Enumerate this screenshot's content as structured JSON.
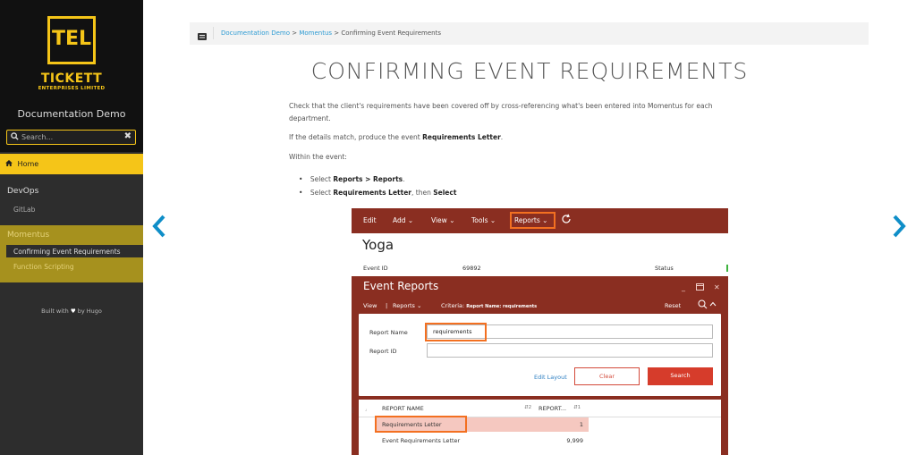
{
  "sidebar": {
    "logo": {
      "mark": "TEL",
      "name": "TICKETT",
      "tagline": "ENTERPRISES LIMITED"
    },
    "site_title": "Documentation Demo",
    "search": {
      "placeholder": "Search..."
    },
    "home_label": "Home",
    "sections": [
      {
        "title": "DevOps",
        "items": [
          "GitLab"
        ]
      },
      {
        "title": "Momentus",
        "items": [
          "Confirming Event Requirements",
          "Function Scripting"
        ]
      }
    ],
    "built_with": {
      "before": "Built with",
      "after": "by Hugo"
    }
  },
  "breadcrumb": {
    "items": [
      "Documentation Demo",
      "Momentus",
      "Confirming Event Requirements"
    ],
    "separator": ">"
  },
  "article": {
    "title": "CONFIRMING EVENT REQUIREMENTS",
    "p1": "Check that the client's requirements have been covered off by cross-referencing what's been entered into Momentus for each department.",
    "p2_before": "If the details match, produce the event",
    "p2_bold": "Requirements Letter",
    "p2_after": ".",
    "p3": "Within the event:",
    "bullet1_before": "Select",
    "bullet1_bold": "Reports > Reports",
    "bullet1_after": ".",
    "bullet2_before": "Select",
    "bullet2_bold1": "Requirements Letter",
    "bullet2_mid": ", then",
    "bullet2_bold2": "Select"
  },
  "screenshot": {
    "menu": [
      "Edit",
      "Add",
      "View",
      "Tools",
      "Reports"
    ],
    "event_name": "Yoga",
    "event_id_label": "Event ID",
    "event_id": "69892",
    "status_label": "Status",
    "panel_title": "Event Reports",
    "sub_view": "View",
    "sub_reports": "Reports",
    "criteria_label": "Criteria:",
    "criteria_value": "Report Name: requirements",
    "reset": "Reset",
    "report_name_label": "Report Name",
    "report_name_value": "requirements",
    "report_id_label": "Report ID",
    "edit_layout": "Edit Layout",
    "clear": "Clear",
    "search": "Search",
    "columns": [
      "REPORT NAME",
      "REPORT..."
    ],
    "rows": [
      {
        "name": "Requirements Letter",
        "value": "1"
      },
      {
        "name": "Event Requirements Letter",
        "value": "9,999"
      }
    ]
  },
  "colors": {
    "accent": "#f5c518",
    "link": "#2d9bd3",
    "momentus_red": "#8a2e21",
    "highlight": "#f37021"
  }
}
